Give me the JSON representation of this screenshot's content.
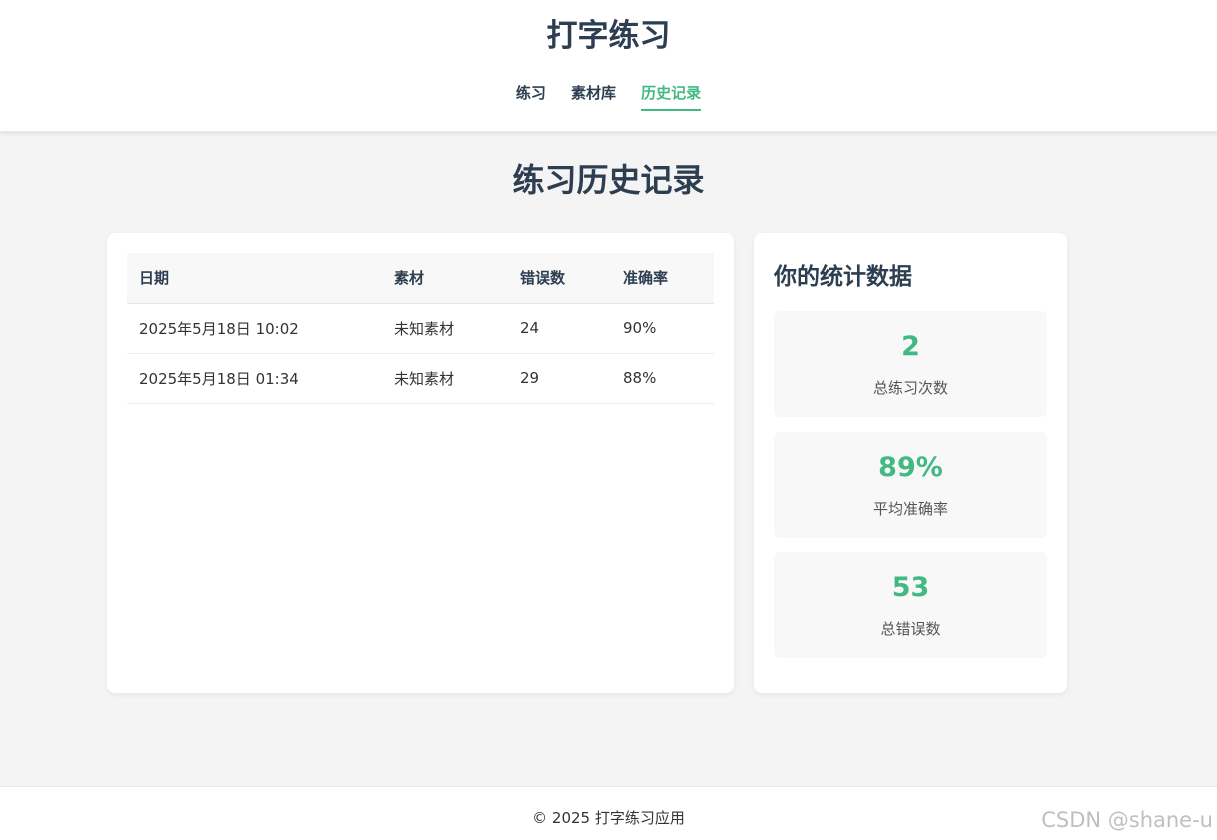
{
  "app": {
    "title": "打字练习",
    "nav": [
      {
        "label": "练习",
        "active": false
      },
      {
        "label": "素材库",
        "active": false
      },
      {
        "label": "历史记录",
        "active": true
      }
    ]
  },
  "page": {
    "heading": "练习历史记录"
  },
  "history": {
    "columns": [
      "日期",
      "素材",
      "错误数",
      "准确率"
    ],
    "rows": [
      [
        "2025年5月18日 10:02",
        "未知素材",
        "24",
        "90%"
      ],
      [
        "2025年5月18日 01:34",
        "未知素材",
        "29",
        "88%"
      ]
    ]
  },
  "stats": {
    "title": "你的统计数据",
    "items": [
      {
        "value": "2",
        "label": "总练习次数"
      },
      {
        "value": "89%",
        "label": "平均准确率"
      },
      {
        "value": "53",
        "label": "总错误数"
      }
    ]
  },
  "footer": {
    "text": "© 2025 打字练习应用"
  },
  "watermark": "CSDN @shane-u",
  "colors": {
    "accent": "#42b983",
    "text": "#2c3e50",
    "background": "#f4f4f4"
  }
}
